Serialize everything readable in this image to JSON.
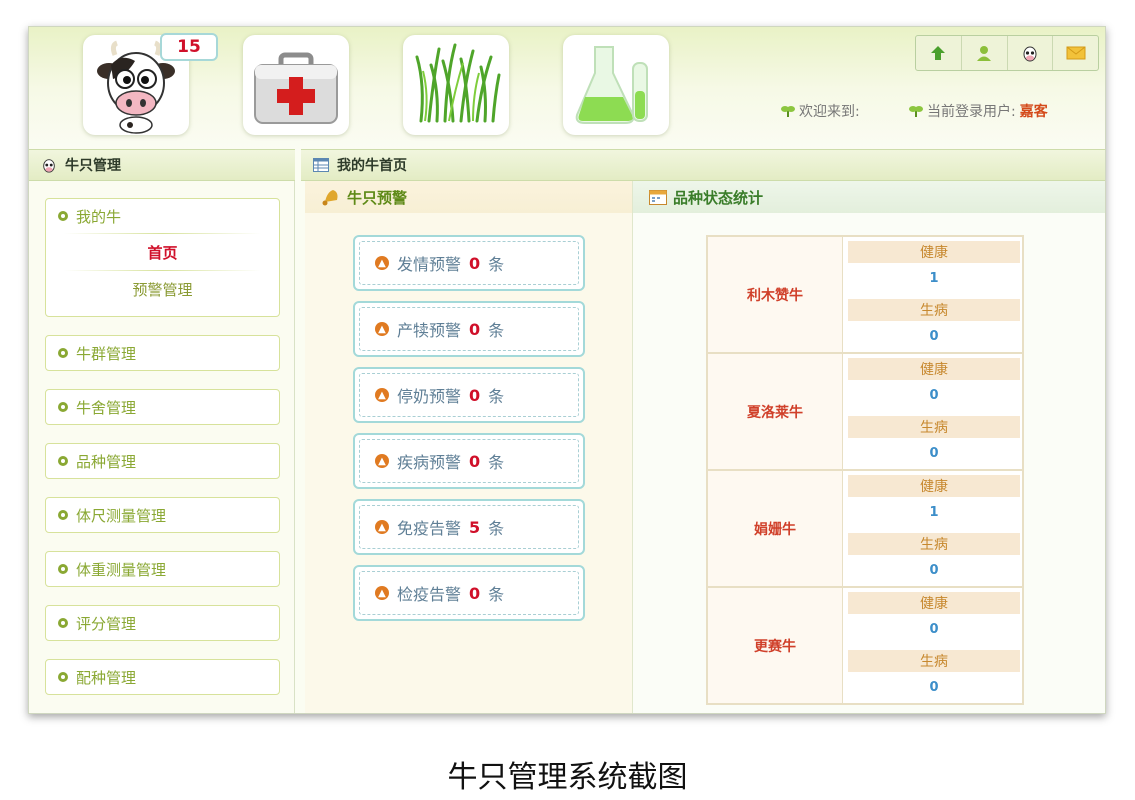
{
  "header": {
    "badge_count": "15",
    "welcome_label": "欢迎来到:",
    "current_user_label": "当前登录用户:",
    "current_user": "嘉客",
    "nav_icons": [
      "cow-icon",
      "medical-kit-icon",
      "grass-icon",
      "lab-flask-icon"
    ],
    "toolbar_icons": [
      "up-arrow-icon",
      "user-icon",
      "cow-head-icon",
      "mail-icon"
    ]
  },
  "sidebar": {
    "title": "牛只管理",
    "expanded_menu": {
      "label": "我的牛",
      "items": [
        {
          "label": "首页",
          "active": true
        },
        {
          "label": "预警管理",
          "active": false
        }
      ]
    },
    "menus": [
      "牛群管理",
      "牛舍管理",
      "品种管理",
      "体尺测量管理",
      "体重测量管理",
      "评分管理",
      "配种管理"
    ]
  },
  "content": {
    "title": "我的牛首页"
  },
  "warnings": {
    "title": "牛只预警",
    "unit": "条",
    "items": [
      {
        "label": "发情预警",
        "count": "0"
      },
      {
        "label": "产犊预警",
        "count": "0"
      },
      {
        "label": "停奶预警",
        "count": "0"
      },
      {
        "label": "疾病预警",
        "count": "0"
      },
      {
        "label": "免疫告警",
        "count": "5"
      },
      {
        "label": "检疫告警",
        "count": "0"
      }
    ]
  },
  "stats": {
    "title": "品种状态统计",
    "healthy_label": "健康",
    "sick_label": "生病",
    "breeds": [
      {
        "name": "利木赞牛",
        "healthy": "1",
        "sick": "0"
      },
      {
        "name": "夏洛莱牛",
        "healthy": "0",
        "sick": "0"
      },
      {
        "name": "娟姗牛",
        "healthy": "1",
        "sick": "0"
      },
      {
        "name": "更赛牛",
        "healthy": "0",
        "sick": "0"
      }
    ]
  },
  "caption": "牛只管理系统截图",
  "colors": {
    "accent_green": "#8aa833",
    "alert_red": "#d0102a",
    "value_blue": "#3c8ec9"
  }
}
